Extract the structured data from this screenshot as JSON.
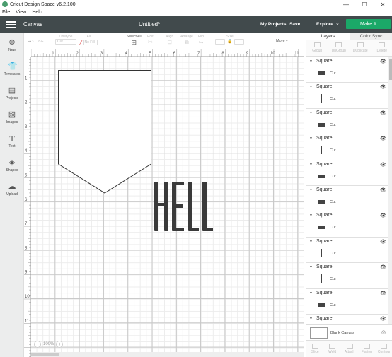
{
  "window": {
    "title": "Cricut Design Space  v6.2.100",
    "controls": [
      "—",
      "☐",
      "✕"
    ]
  },
  "menu": [
    "File",
    "View",
    "Help"
  ],
  "header": {
    "section": "Canvas",
    "doc_title": "Untitled*",
    "my_projects": "My Projects",
    "save": "Save",
    "explore": "Explore",
    "explore_chevron": "⌄",
    "make_it": "Make It",
    "make_it_color": "#1ba868"
  },
  "toolbar": {
    "items": [
      {
        "label": "Linetype",
        "value": "Cut"
      },
      {
        "label": "Fill",
        "value": "No Fill"
      },
      {
        "label": "Select All"
      },
      {
        "label": "Edit"
      },
      {
        "label": "Align"
      },
      {
        "label": "Arrange"
      },
      {
        "label": "Flip"
      },
      {
        "label": "Size"
      },
      {
        "label": "More ▾"
      }
    ]
  },
  "sidebar": {
    "items": [
      {
        "label": "New",
        "icon": "plus-circle-icon",
        "glyph": "⊕"
      },
      {
        "label": "Templates",
        "icon": "tshirt-icon",
        "glyph": "👕"
      },
      {
        "label": "Projects",
        "icon": "projects-icon",
        "glyph": "▤"
      },
      {
        "label": "Images",
        "icon": "image-icon",
        "glyph": "▧"
      },
      {
        "label": "Text",
        "icon": "text-icon",
        "glyph": "T"
      },
      {
        "label": "Shapes",
        "icon": "shapes-icon",
        "glyph": "◈"
      },
      {
        "label": "Upload",
        "icon": "upload-icon",
        "glyph": "☁"
      }
    ]
  },
  "canvas": {
    "ruler_top": [
      "1",
      "2",
      "3",
      "4",
      "5",
      "6",
      "7",
      "8",
      "9",
      "10",
      "11"
    ],
    "ruler_left": [
      "1",
      "2",
      "3",
      "4",
      "5",
      "6",
      "7",
      "8",
      "9",
      "10",
      "11"
    ],
    "text_object": "HELL",
    "zoom": "100%",
    "zoom_minus": "−",
    "zoom_plus": "+"
  },
  "panel": {
    "tabs": [
      "Layers",
      "Color Sync"
    ],
    "actions": [
      "Group",
      "UnGroup",
      "Duplicate",
      "Delete"
    ],
    "layers": [
      {
        "name": "Square",
        "op": "Cut",
        "orient": "h"
      },
      {
        "name": "Square",
        "op": "Cut",
        "orient": "v"
      },
      {
        "name": "Square",
        "op": "Cut",
        "orient": "h"
      },
      {
        "name": "Square",
        "op": "Cut",
        "orient": "v"
      },
      {
        "name": "Square",
        "op": "Cut",
        "orient": "h"
      },
      {
        "name": "Square",
        "op": "Cut",
        "orient": "h"
      },
      {
        "name": "Square",
        "op": "Cut",
        "orient": "h"
      },
      {
        "name": "Square",
        "op": "Cut",
        "orient": "v"
      },
      {
        "name": "Square",
        "op": "Cut",
        "orient": "v"
      },
      {
        "name": "Square",
        "op": "Cut",
        "orient": "h"
      },
      {
        "name": "Square",
        "op": "Cut",
        "orient": "h"
      }
    ],
    "blank_canvas": "Blank Canvas",
    "bottom_actions": [
      "Slice",
      "Weld",
      "Attach",
      "Flatten",
      "Contour"
    ]
  }
}
